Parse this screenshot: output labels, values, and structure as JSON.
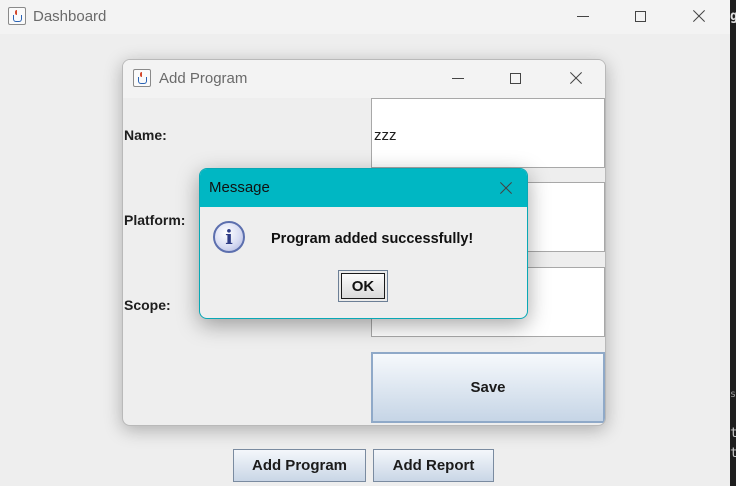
{
  "dashboard": {
    "title": "Dashboard",
    "buttons": {
      "add_program": "Add Program",
      "add_report": "Add Report"
    }
  },
  "add_program_dialog": {
    "title": "Add Program",
    "fields": {
      "name_label": "Name:",
      "name_value": "zzz",
      "platform_label": "Platform:",
      "platform_value": "",
      "scope_label": "Scope:",
      "scope_value": ""
    },
    "save_label": "Save"
  },
  "message_dialog": {
    "title": "Message",
    "text": "Program added successfully!",
    "ok_label": "OK",
    "icon": "info-icon"
  },
  "window_controls": {
    "minimize": "minimize-icon",
    "maximize": "maximize-icon",
    "close": "close-icon"
  },
  "background_partial_text": [
    "g",
    "s",
    "t",
    "t"
  ],
  "colors": {
    "message_titlebar": "#00b7c3",
    "button_gradient_top": "#f4f7fb",
    "button_gradient_bottom": "#c9d6e6",
    "window_bg": "#eeeeee"
  }
}
